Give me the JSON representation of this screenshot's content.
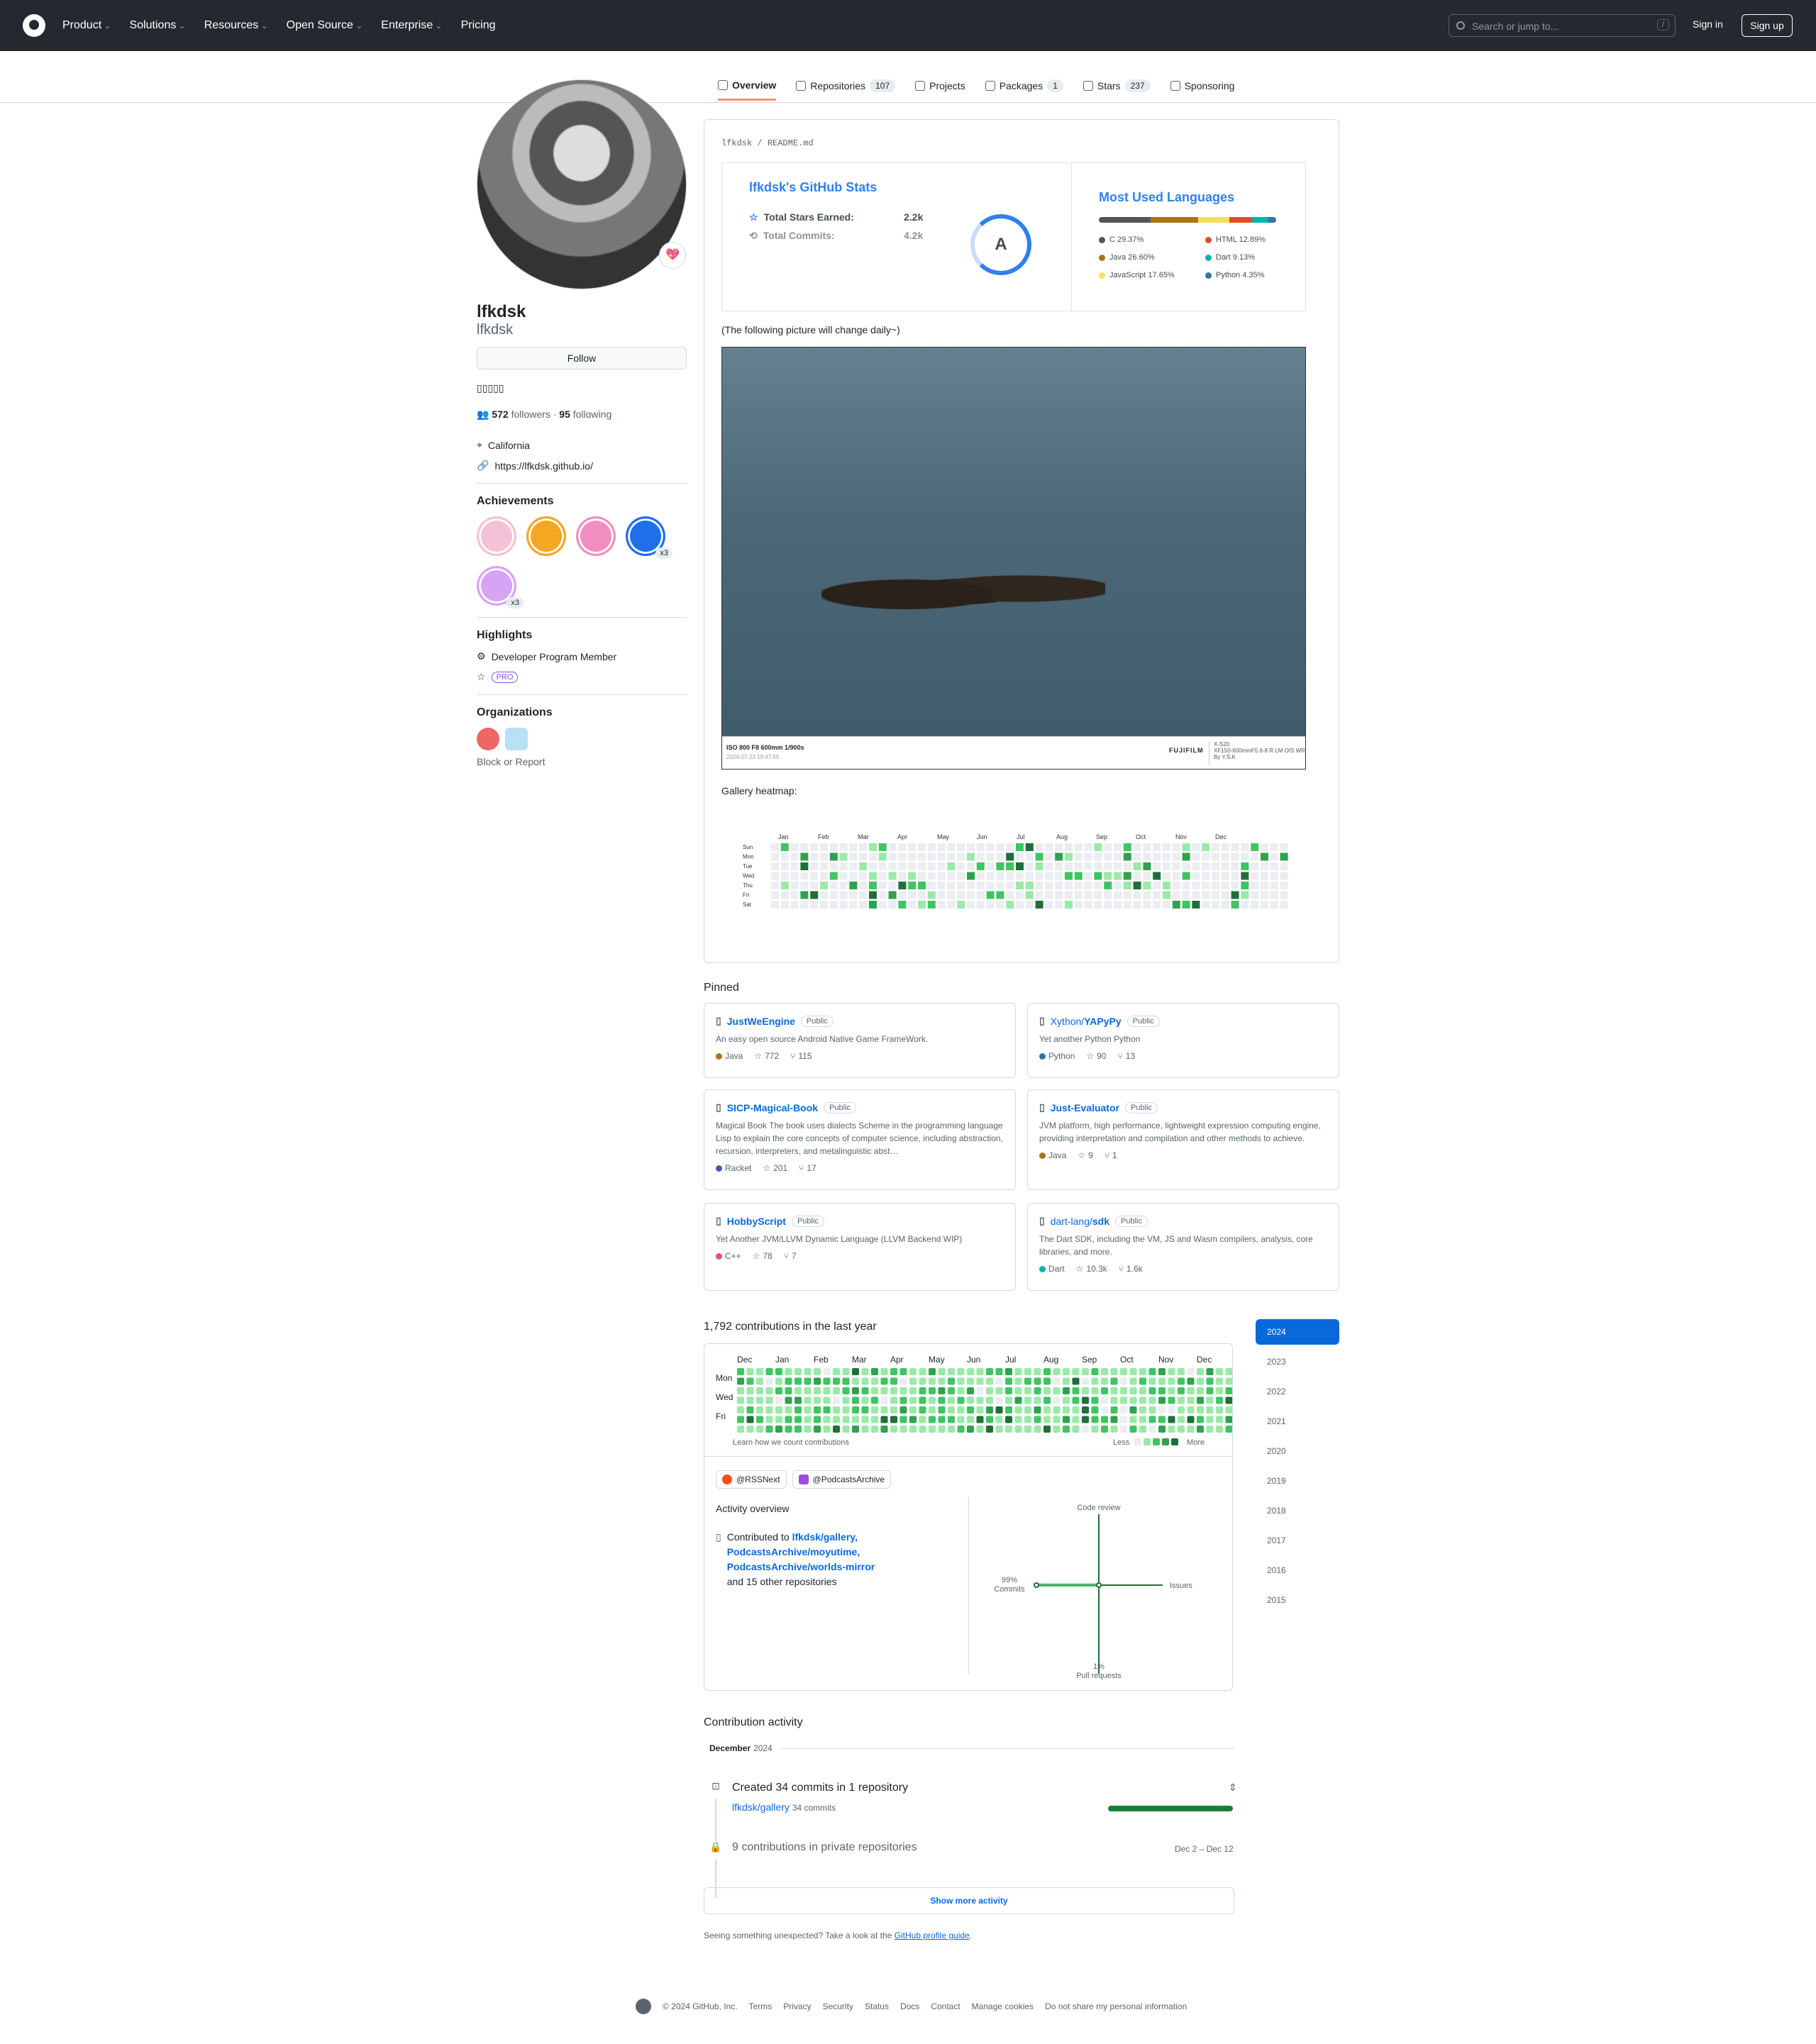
{
  "header": {
    "nav": [
      "Product",
      "Solutions",
      "Resources",
      "Open Source",
      "Enterprise",
      "Pricing"
    ],
    "search_placeholder": "Search or jump to...",
    "search_key": "/",
    "sign_in": "Sign in",
    "sign_up": "Sign up"
  },
  "tabs": [
    {
      "label": "Overview",
      "icon": "book-icon"
    },
    {
      "label": "Repositories",
      "count": "107",
      "icon": "repo-icon"
    },
    {
      "label": "Projects",
      "icon": "table-icon"
    },
    {
      "label": "Packages",
      "count": "1",
      "icon": "package-icon"
    },
    {
      "label": "Stars",
      "count": "237",
      "icon": "star-icon"
    },
    {
      "label": "Sponsoring",
      "icon": "heart-icon"
    }
  ],
  "profile": {
    "name": "lfkdsk",
    "login": "lfkdsk",
    "status_emoji": "💖",
    "follow_label": "Follow",
    "bio": "▯▯▯▯▯",
    "followers": "572",
    "followers_label": "followers",
    "following": "95",
    "following_label": "following",
    "location": "California",
    "url": "https://lfkdsk.github.io/"
  },
  "achievements": {
    "title": "Achievements",
    "items": [
      {
        "name": "heart-on-sleeve",
        "color": "#f4c2d7"
      },
      {
        "name": "starstruck",
        "color": "#f5a623"
      },
      {
        "name": "yolo",
        "color": "#f08ec0"
      },
      {
        "name": "pull-shark",
        "count": "x3",
        "color": "#1f6feb"
      },
      {
        "name": "quickdraw",
        "count": "x3",
        "color": "#d6a3f5"
      }
    ]
  },
  "highlights": {
    "title": "Highlights",
    "developer": "Developer Program Member",
    "pro": "PRO"
  },
  "organizations": {
    "title": "Organizations",
    "block_report": "Block or Report"
  },
  "readme": {
    "path_user": "lfkdsk",
    "path_file": "README.md",
    "stats": {
      "title": "lfkdsk's GitHub Stats",
      "stars_label": "Total Stars Earned:",
      "stars_value": "2.2k",
      "commits_label": "Total Commits:",
      "commits_value": "4.2k",
      "grade": "A"
    },
    "langs": {
      "title": "Most Used Languages",
      "items": [
        {
          "name": "C 29.37%",
          "pct": 29.37,
          "color": "#555555"
        },
        {
          "name": "HTML 12.89%",
          "pct": 12.89,
          "color": "#e34c26"
        },
        {
          "name": "Java 26.60%",
          "pct": 26.6,
          "color": "#b07219"
        },
        {
          "name": "Dart 9.13%",
          "pct": 9.13,
          "color": "#00b4ab"
        },
        {
          "name": "JavaScript 17.65%",
          "pct": 17.65,
          "color": "#f1e05a"
        },
        {
          "name": "Python 4.35%",
          "pct": 4.35,
          "color": "#3572a5"
        }
      ]
    },
    "note": "(The following picture will change daily~)",
    "photo": {
      "exif": "ISO 800 F8 600mm 1/900s",
      "date": "2024-07-23 19:47:55",
      "brand": "FUJIFILM",
      "model": "X-S20",
      "lens": "XF150-600mmF5.6-8 R LM OIS WR",
      "author": "By Y.S.K"
    },
    "gallery_label": "Gallery heatmap:",
    "gallery_months": [
      "Jan",
      "Feb",
      "Mar",
      "Apr",
      "May",
      "Jun",
      "Jul",
      "Aug",
      "Sep",
      "Oct",
      "Nov",
      "Dec"
    ],
    "gallery_days": [
      "Sun",
      "Mon",
      "Tue",
      "Wed",
      "Thu",
      "Fri",
      "Sat"
    ]
  },
  "pinned": {
    "title": "Pinned",
    "items": [
      {
        "owner": "",
        "repo": "JustWeEngine",
        "vis": "Public",
        "desc": "An easy open source Android Native Game FrameWork.",
        "lang": "Java",
        "color": "#b07219",
        "stars": "772",
        "forks": "115"
      },
      {
        "owner": "Xython/",
        "repo": "YAPyPy",
        "vis": "Public",
        "desc": "Yet another Python Python",
        "lang": "Python",
        "color": "#3572a5",
        "stars": "90",
        "forks": "13"
      },
      {
        "owner": "",
        "repo": "SICP-Magical-Book",
        "vis": "Public",
        "desc": "Magical Book The book uses dialects Scheme in the programming language Lisp to explain the core concepts of computer science, including abstraction, recursion, interpreters, and metalinguistic abst…",
        "lang": "Racket",
        "color": "#3c5caa",
        "stars": "201",
        "forks": "17"
      },
      {
        "owner": "",
        "repo": "Just-Evaluator",
        "vis": "Public",
        "desc": "JVM platform, high performance, lightweight expression computing engine, providing interpretation and compilation and other methods to achieve.",
        "lang": "Java",
        "color": "#b07219",
        "stars": "9",
        "forks": "1"
      },
      {
        "owner": "",
        "repo": "HobbyScript",
        "vis": "Public",
        "desc": "Yet Another JVM/LLVM Dynamic Language (LLVM Backend WIP)",
        "lang": "C++",
        "color": "#f34b7d",
        "stars": "78",
        "forks": "7"
      },
      {
        "owner": "dart-lang/",
        "repo": "sdk",
        "vis": "Public",
        "desc": "The Dart SDK, including the VM, JS and Wasm compilers, analysis, core libraries, and more.",
        "lang": "Dart",
        "color": "#00b4ab",
        "stars": "10.3k",
        "forks": "1.6k"
      }
    ]
  },
  "contrib": {
    "title": "1,792 contributions in the last year",
    "months": [
      "Dec",
      "Jan",
      "Feb",
      "Mar",
      "Apr",
      "May",
      "Jun",
      "Jul",
      "Aug",
      "Sep",
      "Oct",
      "Nov",
      "Dec"
    ],
    "days": [
      "Mon",
      "Wed",
      "Fri"
    ],
    "learn": "Learn how we count contributions",
    "less": "Less",
    "more": "More",
    "orgs": [
      "@RSSNext",
      "@PodcastsArchive"
    ],
    "overview_title": "Activity overview",
    "contributed_to": "Contributed to",
    "repos": [
      "lfkdsk/gallery,",
      "PodcastsArchive/moyutime,",
      "PodcastsArchive/worlds-mirror"
    ],
    "others": "and 15 other repositories",
    "axes": {
      "code_review": "Code review",
      "issues": "Issues",
      "commits_pct": "99%",
      "commits": "Commits",
      "pr_pct": "1%",
      "pr": "Pull requests"
    }
  },
  "years": [
    "2024",
    "2023",
    "2022",
    "2021",
    "2020",
    "2019",
    "2018",
    "2017",
    "2016",
    "2015"
  ],
  "activity": {
    "title": "Contribution activity",
    "month": "December",
    "year": "2024",
    "commits_line": "Created 34 commits in 1 repository",
    "repo": "lfkdsk/gallery",
    "repo_commits": "34 commits",
    "private": "9 contributions in private repositories",
    "range": "Dec 2 – Dec 12",
    "show_more": "Show more activity",
    "unexpected": "Seeing something unexpected? Take a look at the",
    "guide": "GitHub profile guide",
    "period": "."
  },
  "footer": {
    "copyright": "© 2024 GitHub, Inc.",
    "links": [
      "Terms",
      "Privacy",
      "Security",
      "Status",
      "Docs",
      "Contact",
      "Manage cookies",
      "Do not share my personal information"
    ]
  }
}
